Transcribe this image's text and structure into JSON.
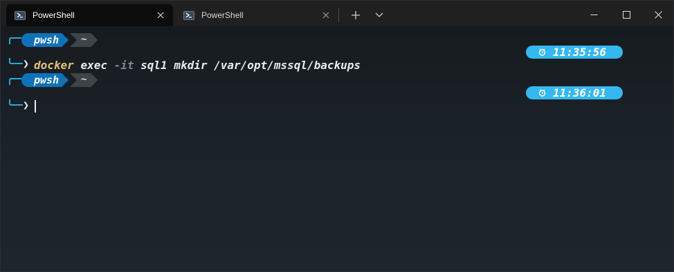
{
  "tabs": [
    {
      "label": "PowerShell",
      "active": true
    },
    {
      "label": "PowerShell",
      "active": false
    }
  ],
  "prompts": [
    {
      "shell": "pwsh",
      "path": "~",
      "time": "11:35:56",
      "command": {
        "cmd": "docker",
        "arg1": "exec",
        "flag": "-it",
        "rest": "sql1 mkdir /var/opt/mssql/backups"
      }
    },
    {
      "shell": "pwsh",
      "path": "~",
      "time": "11:36:01",
      "command": null
    }
  ],
  "colors": {
    "shell_segment": "#0e72b8",
    "path_segment": "#3f4449",
    "clock": "#35b8f0",
    "command": "#e5c07b",
    "frame": "#29a8e0"
  },
  "icons": {
    "tab": "powershell-icon",
    "close": "close-icon",
    "new_tab": "plus-icon",
    "dropdown": "chevron-down-icon",
    "minimize": "minimize-icon",
    "maximize": "maximize-icon",
    "window_close": "window-close-icon",
    "clock": "clock-icon"
  }
}
